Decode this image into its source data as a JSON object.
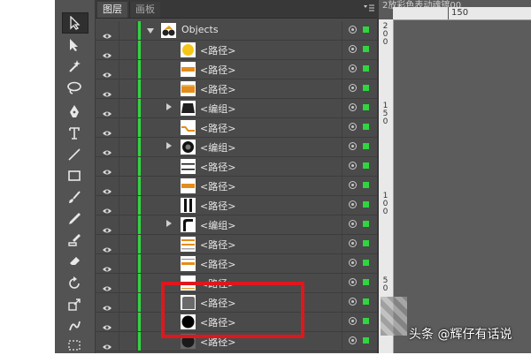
{
  "panel": {
    "tabs": [
      {
        "label": "图层"
      },
      {
        "label": "画板"
      }
    ],
    "menu_icon": "panel-menu-icon"
  },
  "layers": [
    {
      "label": "Objects",
      "thumb": "objects-thumb",
      "expand": "open",
      "level": 0
    },
    {
      "label": "<路径>",
      "thumb": "yellow-circle",
      "expand": "none",
      "level": 1
    },
    {
      "label": "<路径>",
      "thumb": "orange-stripe-wide",
      "expand": "none",
      "level": 1
    },
    {
      "label": "<路径>",
      "thumb": "orange-block",
      "expand": "none",
      "level": 1
    },
    {
      "label": "<编组>",
      "thumb": "dark-trapezoid",
      "expand": "closed",
      "level": 1
    },
    {
      "label": "<路径>",
      "thumb": "orange-wave",
      "expand": "none",
      "level": 1
    },
    {
      "label": "<编组>",
      "thumb": "black-ring",
      "expand": "closed",
      "level": 1
    },
    {
      "label": "<路径>",
      "thumb": "black-lines",
      "expand": "none",
      "level": 1
    },
    {
      "label": "<路径>",
      "thumb": "orange-stripe",
      "expand": "none",
      "level": 1
    },
    {
      "label": "<路径>",
      "thumb": "black-bars",
      "expand": "none",
      "level": 1
    },
    {
      "label": "<编组>",
      "thumb": "black-corner",
      "expand": "closed",
      "level": 1
    },
    {
      "label": "<路径>",
      "thumb": "orange-lines",
      "expand": "none",
      "level": 1
    },
    {
      "label": "<路径>",
      "thumb": "orange-thin-stripe",
      "expand": "none",
      "level": 1
    },
    {
      "label": "<路径>",
      "thumb": "line-thin",
      "expand": "none",
      "level": 1
    },
    {
      "label": "<路径>",
      "thumb": "grey-blob",
      "expand": "none",
      "level": 1
    },
    {
      "label": "<路径>",
      "thumb": "black-circle",
      "expand": "none",
      "level": 1
    },
    {
      "label": "<路径>",
      "thumb": "black-circle-dark",
      "expand": "none",
      "level": 1
    }
  ],
  "ruler": {
    "h_label": "150",
    "v_labels": [
      "200",
      "150",
      "100",
      "50"
    ]
  },
  "doc_title": "2放彩色表动魂镀00",
  "watermark": "头条 @辉仔有话说",
  "colors": {
    "layer_color": "#30d540",
    "highlight": "#e1161d",
    "panel_bg": "#4b4b4b"
  }
}
